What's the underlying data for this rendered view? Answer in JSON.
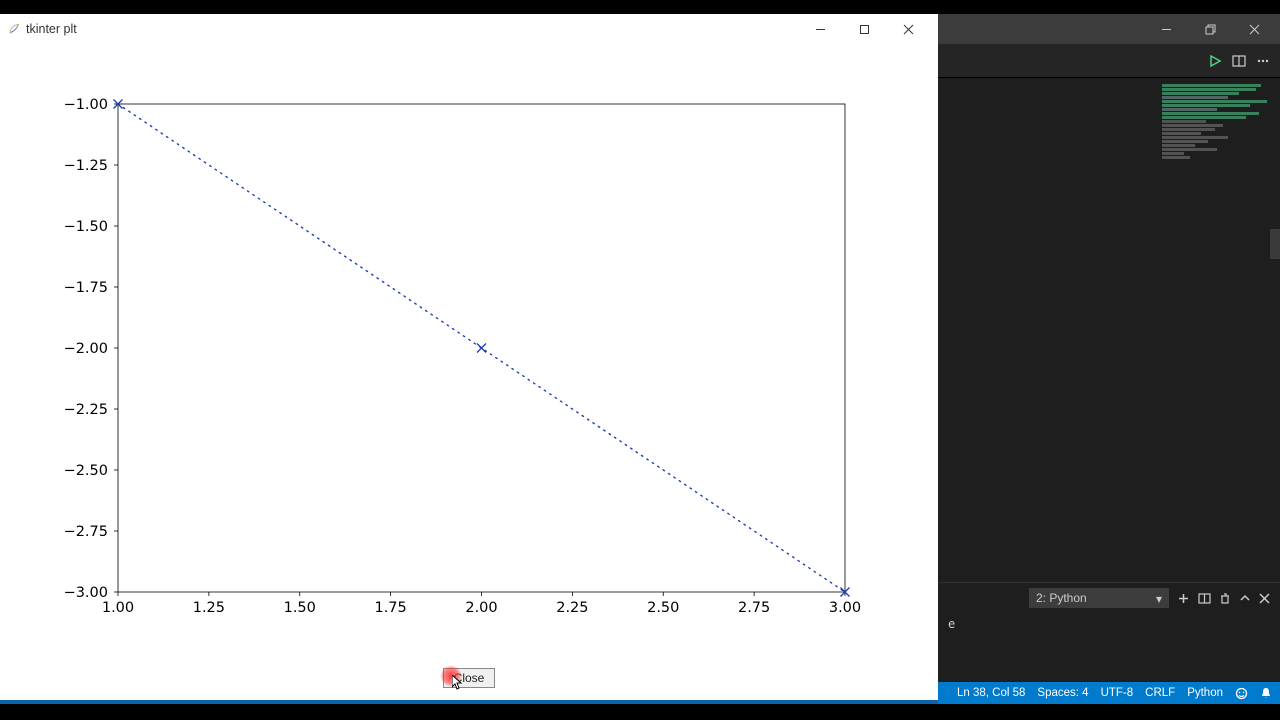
{
  "tk_window": {
    "title": "tkinter plt",
    "close_button_label": "Close"
  },
  "chart_data": {
    "type": "line",
    "x": [
      1,
      2,
      3
    ],
    "y": [
      -1,
      -2,
      -3
    ],
    "marker": "x",
    "linestyle": "dotted",
    "color": "#1f3db5",
    "title": "",
    "xlabel": "",
    "ylabel": "",
    "xlim": [
      1.0,
      3.0
    ],
    "ylim": [
      -3.0,
      -1.0
    ],
    "xticks": [
      1.0,
      1.25,
      1.5,
      1.75,
      2.0,
      2.25,
      2.5,
      2.75,
      3.0
    ],
    "yticks": [
      -1.0,
      -1.25,
      -1.5,
      -1.75,
      -2.0,
      -2.25,
      -2.5,
      -2.75,
      -3.0
    ],
    "xtick_labels": [
      "1.00",
      "1.25",
      "1.50",
      "1.75",
      "2.00",
      "2.25",
      "2.50",
      "2.75",
      "3.00"
    ],
    "ytick_labels": [
      "−1.00",
      "−1.25",
      "−1.50",
      "−1.75",
      "−2.00",
      "−2.25",
      "−2.50",
      "−2.75",
      "−3.00"
    ]
  },
  "vscode": {
    "terminal": {
      "selector_label": "2: Python",
      "output_tail": "e"
    },
    "status": {
      "ln_col": "Ln 38, Col 58",
      "spaces": "Spaces: 4",
      "encoding": "UTF-8",
      "eol": "CRLF",
      "language": "Python"
    }
  }
}
